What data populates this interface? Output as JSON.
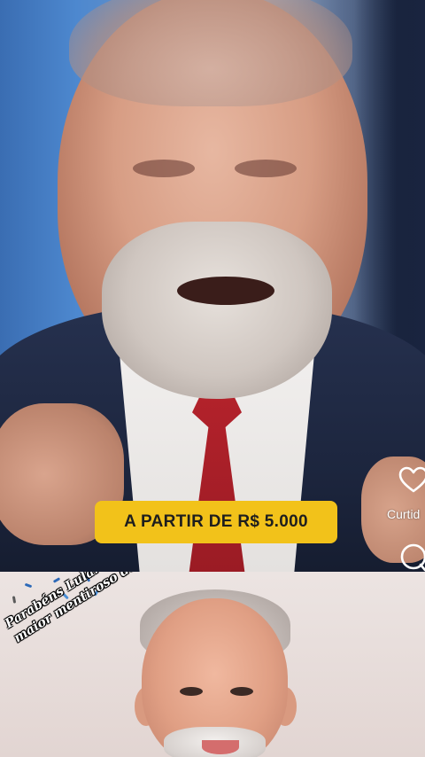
{
  "video": {
    "price_badge": "A PARTIR DE R$ 5.000"
  },
  "actions": {
    "like_label": "Curtid",
    "like_icon": "heart-icon",
    "comment_icon": "comment-icon"
  },
  "meme": {
    "caption_line1": "Parabéns Lula! Por ser o",
    "caption_line2": "maior mentiroso do Brasil!"
  },
  "colors": {
    "badge": "#f2c21a",
    "tie": "#b3222b",
    "suit": "#1c253d"
  }
}
